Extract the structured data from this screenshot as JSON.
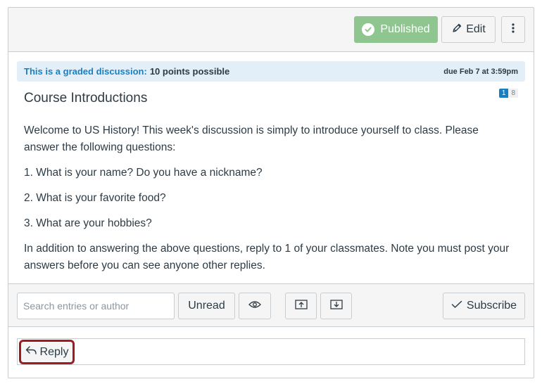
{
  "toolbar": {
    "published_label": "Published",
    "edit_label": "Edit"
  },
  "banner": {
    "graded_label": "This is a graded discussion:",
    "points": "10 points possible",
    "due": "due Feb 7 at 3:59pm"
  },
  "topic": {
    "title": "Course Introductions",
    "unread_count": "1",
    "total_count": "8",
    "paragraphs": [
      "Welcome to US History! This week's discussion is simply to introduce yourself to class. Please answer the following questions:",
      "1. What is your name? Do you have a nickname?",
      "2. What is your favorite food?",
      "3. What are your hobbies?",
      "In addition to answering the above questions, reply to 1 of your classmates. Note you must post your answers before you can see anyone other replies."
    ]
  },
  "controls": {
    "search_placeholder": "Search entries or author",
    "unread_label": "Unread",
    "subscribe_label": "Subscribe"
  },
  "reply": {
    "label": "Reply"
  },
  "colors": {
    "published_green": "#8fc690",
    "link_blue": "#1a7fc1",
    "banner_bg": "#e2eff8",
    "highlight_red": "#9c1c21"
  }
}
